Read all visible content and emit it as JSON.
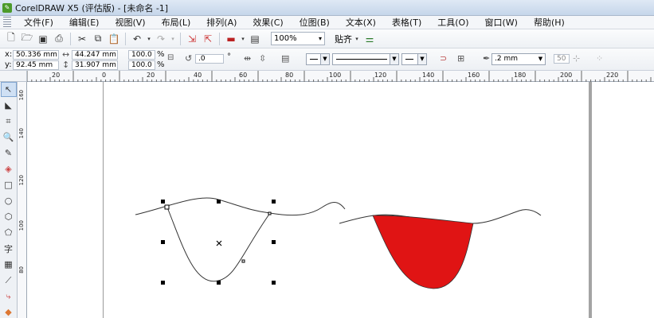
{
  "window": {
    "title": "CorelDRAW X5 (评估版) - [未命名 -1]",
    "app_icon": "coreldraw-icon"
  },
  "menu": {
    "items": [
      "文件(F)",
      "编辑(E)",
      "视图(V)",
      "布局(L)",
      "排列(A)",
      "效果(C)",
      "位图(B)",
      "文本(X)",
      "表格(T)",
      "工具(O)",
      "窗口(W)",
      "帮助(H)"
    ]
  },
  "toolbar": {
    "zoom_value": "100%",
    "snap_label": "贴齐"
  },
  "property_bar": {
    "x_label": "x:",
    "x_value": "50.336 mm",
    "y_label": "y:",
    "y_value": "92.45 mm",
    "width_value": "44.247 mm",
    "height_value": "31.907 mm",
    "scale_x": "100.0",
    "scale_y": "100.0",
    "percent": "%",
    "rotation": ".0",
    "degree": "°",
    "outline_width": ".2 mm",
    "smoothing": "50"
  },
  "ruler": {
    "h_labels": [
      "20",
      "0",
      "20",
      "40",
      "60",
      "80",
      "100",
      "120",
      "140",
      "160",
      "180",
      "200",
      "220"
    ],
    "v_labels": [
      "160",
      "140",
      "120",
      "100",
      "80"
    ]
  },
  "colors": {
    "fill_red": "#e01414",
    "curve_stroke": "#333333",
    "handle": "#000000"
  }
}
